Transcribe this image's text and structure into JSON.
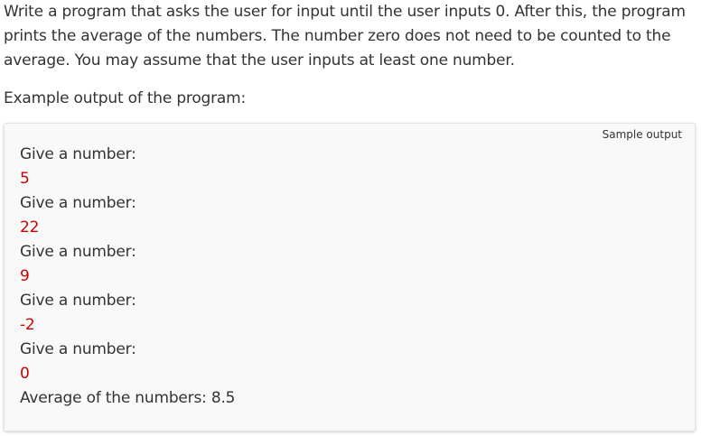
{
  "description": "Write a program that asks the user for input until the user inputs 0. After this, the program prints the average of the numbers. The number zero does not need to be counted to the average. You may assume that the user inputs at least one number.",
  "example_heading": "Example output of the program:",
  "sample": {
    "label": "Sample output",
    "input_color": "#cc0000",
    "lines": [
      {
        "text": "Give a number:",
        "kind": "prompt"
      },
      {
        "text": "5",
        "kind": "input"
      },
      {
        "text": "Give a number:",
        "kind": "prompt"
      },
      {
        "text": "22",
        "kind": "input"
      },
      {
        "text": "Give a number:",
        "kind": "prompt"
      },
      {
        "text": "9",
        "kind": "input"
      },
      {
        "text": "Give a number:",
        "kind": "prompt"
      },
      {
        "text": "-2",
        "kind": "input"
      },
      {
        "text": "Give a number:",
        "kind": "prompt"
      },
      {
        "text": "0",
        "kind": "input"
      },
      {
        "text": "Average of the numbers: 8.5",
        "kind": "prompt"
      }
    ]
  }
}
